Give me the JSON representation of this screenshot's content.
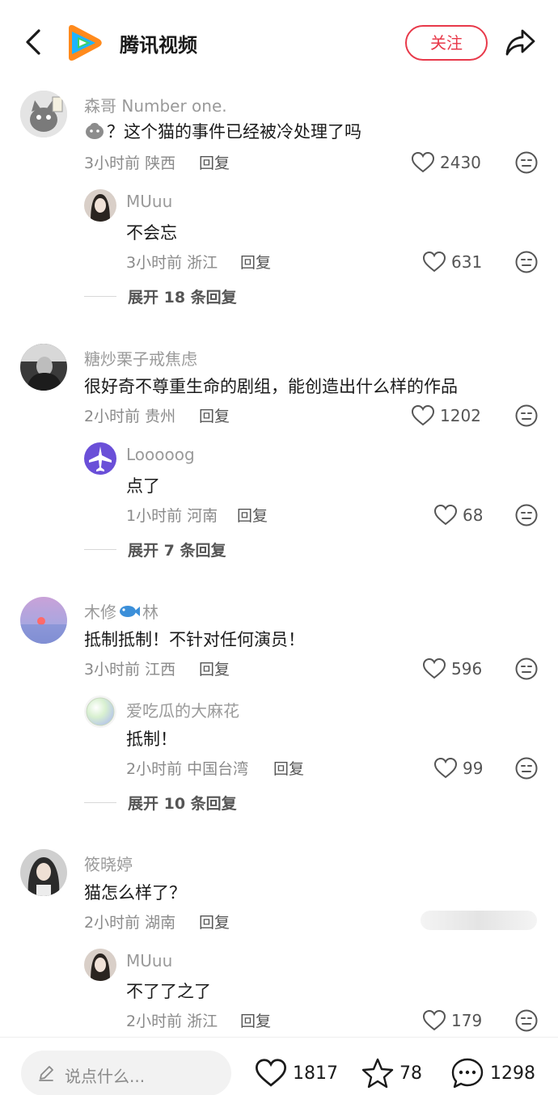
{
  "header": {
    "app_name": "腾讯视频",
    "follow_label": "关注"
  },
  "comments": [
    {
      "user": "森哥 Number one.",
      "text": "？这个猫的事件已经被冷处理了吗",
      "meta": "3小时前 陕西",
      "reply_label": "回复",
      "likes": "2430",
      "reply": {
        "user": "MUuu",
        "text": "不会忘",
        "meta": "3小时前 浙江",
        "reply_label": "回复",
        "likes": "631"
      },
      "expand": "展开 18 条回复"
    },
    {
      "user": "糖炒栗子戒焦虑",
      "text": "很好奇不尊重生命的剧组，能创造出什么样的作品",
      "meta": "2小时前 贵州",
      "reply_label": "回复",
      "likes": "1202",
      "reply": {
        "user": "Looooog",
        "text": "点了",
        "meta": "1小时前 河南",
        "reply_label": "回复",
        "likes": "68"
      },
      "expand": "展开 7 条回复"
    },
    {
      "user_prefix": "木修",
      "user_suffix": "林",
      "text": "抵制抵制！不针对任何演员！",
      "meta": "3小时前 江西",
      "reply_label": "回复",
      "likes": "596",
      "reply": {
        "user": "爱吃瓜的大麻花",
        "text": "抵制！",
        "meta": "2小时前 中国台湾",
        "reply_label": "回复",
        "likes": "99"
      },
      "expand": "展开 10 条回复"
    },
    {
      "user": "筱晓婷",
      "text": "猫怎么样了？",
      "meta": "2小时前 湖南",
      "reply_label": "回复",
      "reply": {
        "user": "MUuu",
        "text": "不了了之了",
        "meta": "2小时前 浙江",
        "reply_label": "回复",
        "likes": "179"
      }
    }
  ],
  "bottom_bar": {
    "placeholder": "说点什么...",
    "likes": "1817",
    "favorites": "78",
    "comments": "1298"
  },
  "colors": {
    "accent": "#e8394a",
    "muted_text": "#9a9a9a"
  }
}
